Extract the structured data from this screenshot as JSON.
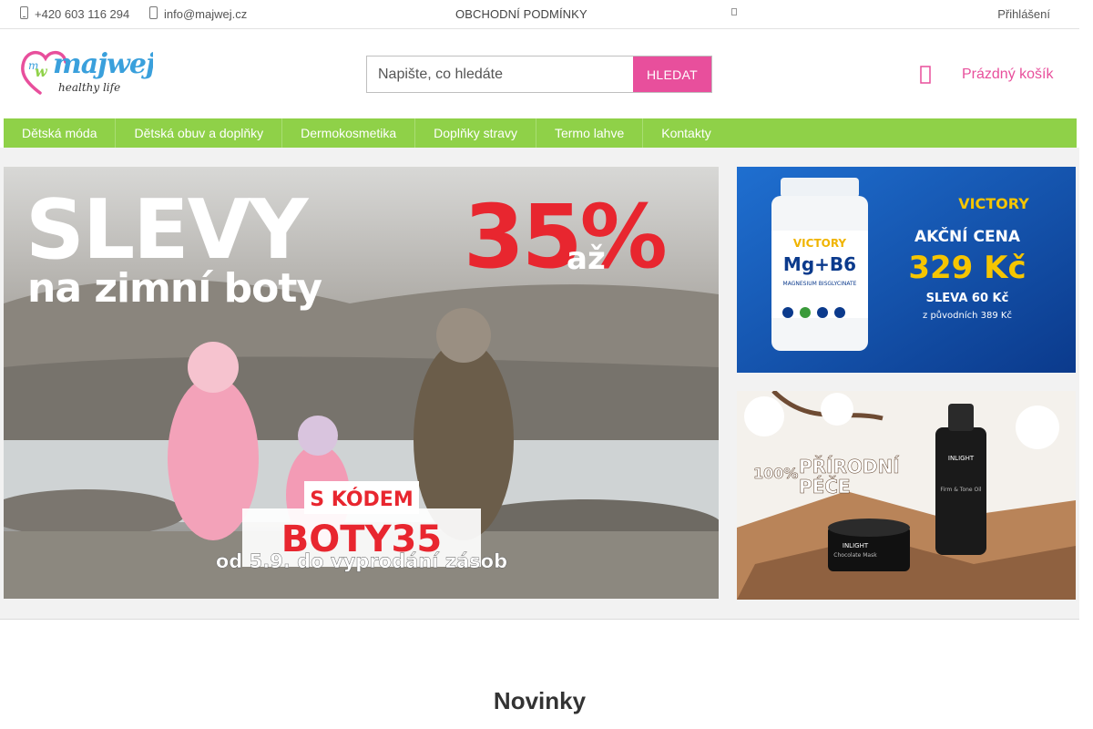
{
  "topbar": {
    "phone": "+420 603 116 294",
    "email": "info@majwej.cz",
    "terms": "OBCHODNÍ PODMÍNKY",
    "login": "Přihlášení"
  },
  "header": {
    "logo_text": "majwej",
    "logo_tagline": "healthy life",
    "logo_monogram": "m w",
    "search_placeholder": "Napište, co hledáte",
    "search_button": "HLEDAT",
    "cart_label": "Prázdný košík"
  },
  "nav": {
    "items": [
      {
        "label": "Dětská móda"
      },
      {
        "label": "Dětská obuv a doplňky"
      },
      {
        "label": "Dermokosmetika"
      },
      {
        "label": "Doplňky stravy"
      },
      {
        "label": "Termo lahve"
      },
      {
        "label": "Kontakty"
      }
    ]
  },
  "banners": {
    "main": {
      "headline": "SLEVY",
      "subline": "na zimní boty",
      "discount": "35%",
      "discount_prefix": "až",
      "code_label": "S KÓDEM",
      "code": "BOTY35",
      "validity": "od 5.9. do vyprodání zásob"
    },
    "victory": {
      "brand": "VICTORY",
      "promo": "AKČNÍ CENA",
      "price": "329 Kč",
      "discount": "SLEVA 60 Kč",
      "original": "z původních 389 Kč",
      "product_brand": "VICTORY",
      "product_name": "Mg+B6",
      "product_desc": "MAGNESIUM BISGLYCINATE"
    },
    "natural": {
      "text1": "100%",
      "text2": "PŘÍRODNÍ",
      "text3": "PÉČE",
      "product_1": "Chocolate Mask",
      "product_2": "Firm & Tone Oil",
      "brand": "INLIGHT"
    }
  },
  "sections": {
    "new_title": "Novinky"
  },
  "colors": {
    "accent_pink": "#e84f9c",
    "nav_green": "#8fd148"
  }
}
